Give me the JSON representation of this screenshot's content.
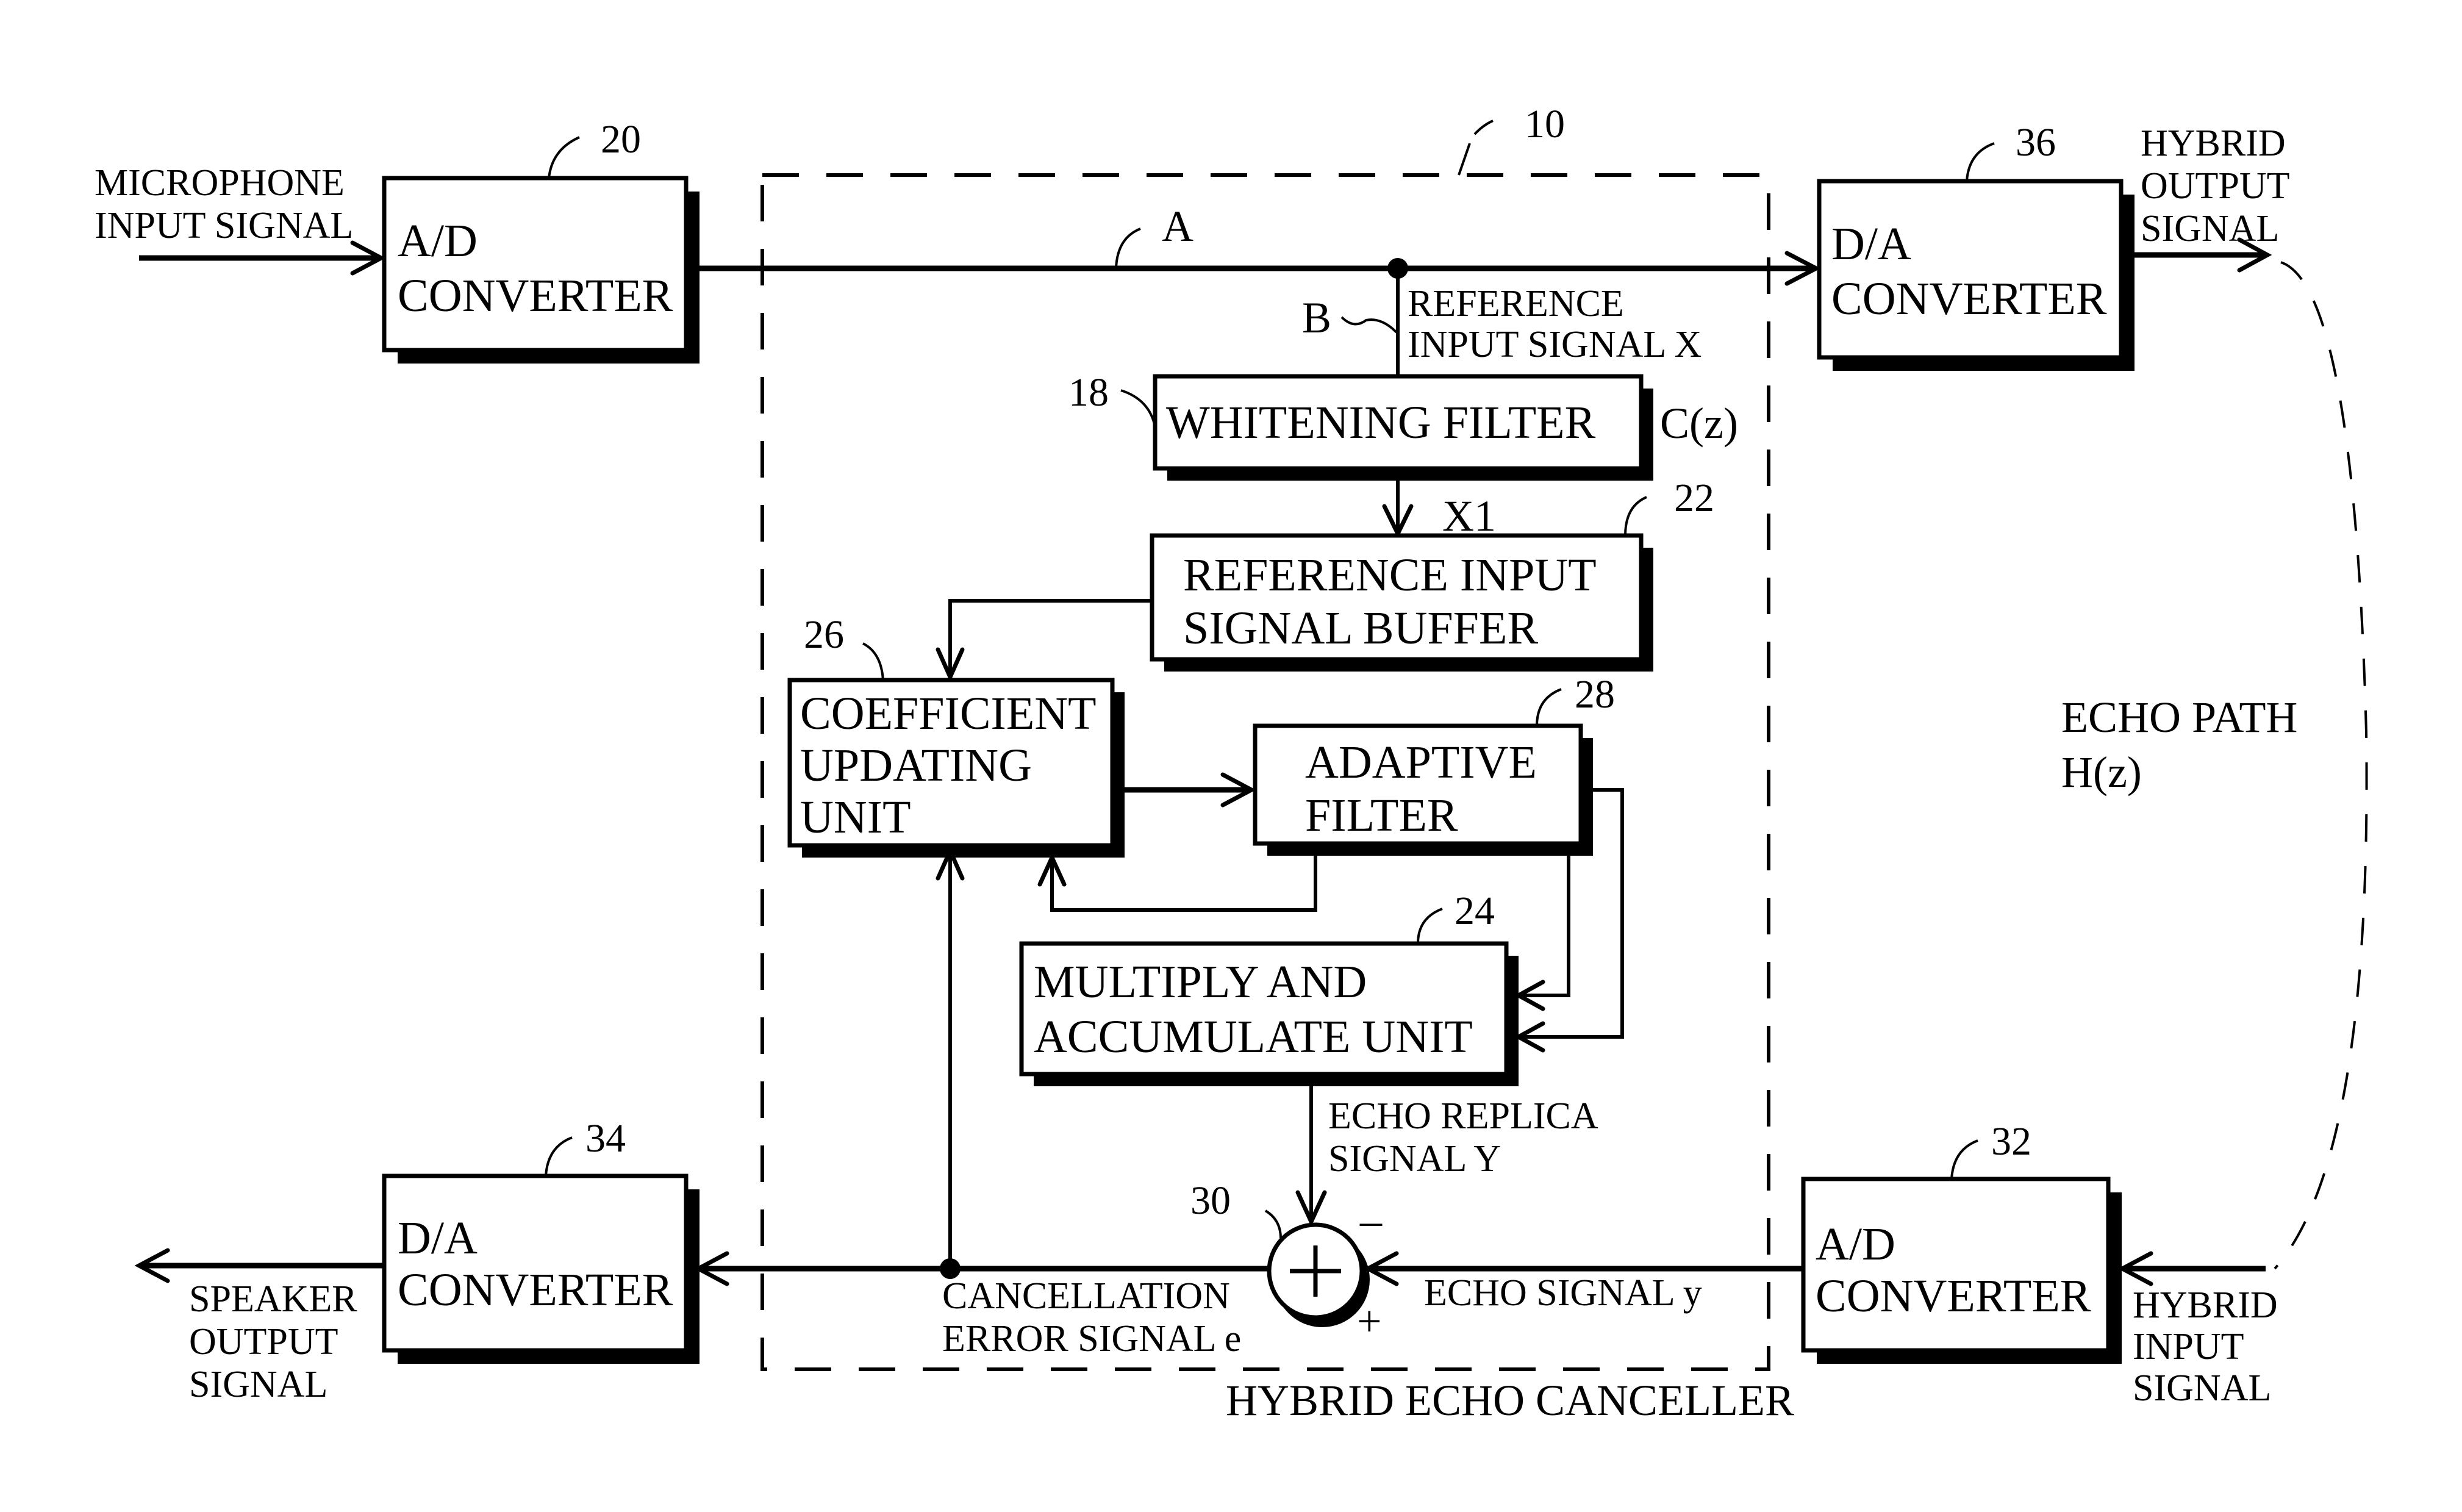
{
  "diagram": {
    "title": "HYBRID ECHO CANCELLER",
    "colors": {
      "ink": "#000000",
      "paper": "#ffffff"
    },
    "canceller": {
      "ref": "10",
      "label": "HYBRID ECHO CANCELLER"
    },
    "blocks": {
      "ad_in": {
        "ref": "20",
        "lines": [
          "A/D",
          "CONVERTER"
        ]
      },
      "da_out": {
        "ref": "36",
        "lines": [
          "D/A",
          "CONVERTER"
        ]
      },
      "whitening": {
        "ref": "18",
        "lines": [
          "WHITENING FILTER"
        ],
        "transfer": "C(z)"
      },
      "buffer": {
        "ref": "22",
        "lines": [
          "REFERENCE INPUT",
          "SIGNAL BUFFER"
        ]
      },
      "coeff": {
        "ref": "26",
        "lines": [
          "COEFFICIENT",
          "UPDATING",
          "UNIT"
        ]
      },
      "adaptive": {
        "ref": "28",
        "lines": [
          "ADAPTIVE",
          "FILTER"
        ]
      },
      "mac": {
        "ref": "24",
        "lines": [
          "MULTIPLY AND",
          "ACCUMULATE UNIT"
        ]
      },
      "da_spk": {
        "ref": "34",
        "lines": [
          "D/A",
          "CONVERTER"
        ]
      },
      "ad_hyb": {
        "ref": "32",
        "lines": [
          "A/D",
          "CONVERTER"
        ]
      }
    },
    "summer": {
      "ref": "30",
      "symbol": "+",
      "minus": "–",
      "plus": "+"
    },
    "signals": {
      "mic_in": [
        "MICROPHONE",
        "INPUT SIGNAL"
      ],
      "hybrid_out": [
        "HYBRID",
        "OUTPUT",
        "SIGNAL"
      ],
      "node_a": "A",
      "node_b": "B",
      "ref_input": [
        "REFERENCE",
        "INPUT SIGNAL X"
      ],
      "x1": "X1",
      "echo_replica": [
        "ECHO REPLICA",
        "SIGNAL  Y"
      ],
      "echo_signal": "ECHO SIGNAL  y",
      "error": [
        "CANCELLATION",
        "ERROR SIGNAL e"
      ],
      "speaker_out": [
        "SPEAKER",
        "OUTPUT",
        "SIGNAL"
      ],
      "hybrid_in": [
        "HYBRID",
        "INPUT",
        "SIGNAL"
      ],
      "echo_path": [
        "ECHO PATH",
        "H(z)"
      ]
    }
  }
}
